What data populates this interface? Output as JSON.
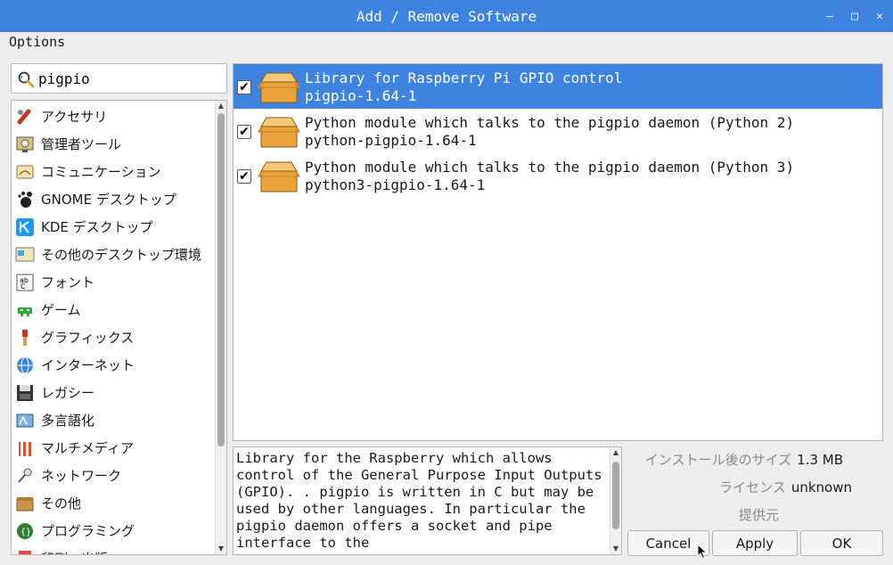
{
  "window": {
    "title": "Add / Remove Software",
    "controls": [
      "–",
      "□",
      "✕"
    ]
  },
  "menu": {
    "options": "Options"
  },
  "search": {
    "value": "pigpio",
    "icon": "search-icon"
  },
  "categories": [
    {
      "label": "アクセサリ",
      "icon": "accessories-icon"
    },
    {
      "label": "管理者ツール",
      "icon": "admin-tools-icon"
    },
    {
      "label": "コミュニケーション",
      "icon": "communication-icon"
    },
    {
      "label": "GNOME デスクトップ",
      "icon": "gnome-icon"
    },
    {
      "label": "KDE デスクトップ",
      "icon": "kde-icon"
    },
    {
      "label": "その他のデスクトップ環境",
      "icon": "other-desktop-icon"
    },
    {
      "label": "フォント",
      "icon": "font-icon"
    },
    {
      "label": "ゲーム",
      "icon": "game-icon"
    },
    {
      "label": "グラフィックス",
      "icon": "graphics-icon"
    },
    {
      "label": "インターネット",
      "icon": "internet-icon"
    },
    {
      "label": "レガシー",
      "icon": "legacy-icon"
    },
    {
      "label": "多言語化",
      "icon": "localization-icon"
    },
    {
      "label": "マルチメディア",
      "icon": "multimedia-icon"
    },
    {
      "label": "ネットワーク",
      "icon": "network-icon"
    },
    {
      "label": "その他",
      "icon": "other-icon"
    },
    {
      "label": "プログラミング",
      "icon": "programming-icon"
    },
    {
      "label": "印刷・出版",
      "icon": "publishing-icon"
    }
  ],
  "packages": [
    {
      "summary": "Library for Raspberry Pi GPIO control",
      "id": "pigpio-1.64-1",
      "checked": true,
      "selected": true
    },
    {
      "summary": "Python module which talks to the pigpio daemon (Python 2)",
      "id": "python-pigpio-1.64-1",
      "checked": true,
      "selected": false
    },
    {
      "summary": "Python module which talks to the pigpio daemon (Python 3)",
      "id": "python3-pigpio-1.64-1",
      "checked": true,
      "selected": false
    }
  ],
  "description": "Library for the Raspberry which allows control of the General Purpose Input Outputs (GPIO). . pigpio is written in C but may be used by other languages. In particular the pigpio daemon offers a socket and pipe interface to the",
  "details": {
    "installed_size_label": "インストール後のサイズ",
    "installed_size_value": "1.3 MB",
    "license_label": "ライセンス",
    "license_value": "unknown",
    "provider_label": "提供元",
    "provider_value": ""
  },
  "buttons": {
    "cancel": "Cancel",
    "apply": "Apply",
    "ok": "OK"
  },
  "colors": {
    "titlebar": "#3d83df",
    "selection": "#3d83df",
    "package_box": "#e9a33a"
  }
}
